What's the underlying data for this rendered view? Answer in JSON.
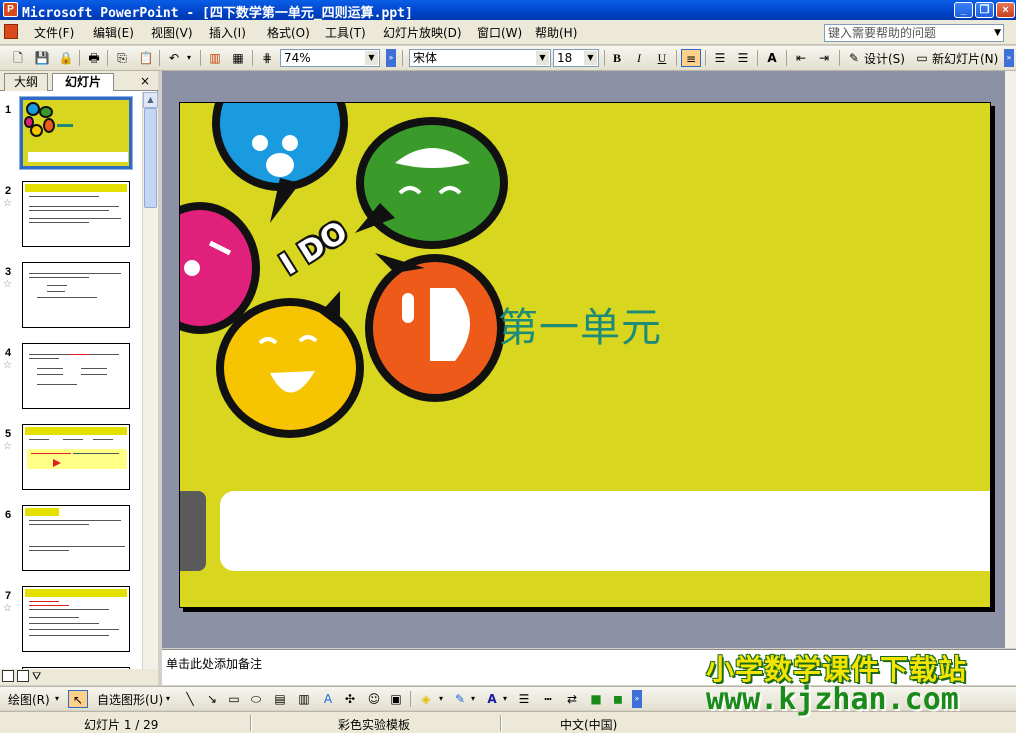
{
  "window": {
    "title": "Microsoft PowerPoint - [四下数学第一单元_四则运算.ppt]"
  },
  "menu": {
    "items": [
      "文件(F)",
      "编辑(E)",
      "视图(V)",
      "插入(I)",
      "格式(O)",
      "工具(T)",
      "幻灯片放映(D)",
      "窗口(W)",
      "帮助(H)"
    ],
    "help_placeholder": "键入需要帮助的问题"
  },
  "toolbar": {
    "zoom": "74%",
    "font": "宋体",
    "size": "18",
    "bold": "B",
    "italic": "I",
    "underline": "U",
    "design": "设计(S)",
    "new_slide": "新幻灯片(N)"
  },
  "pane": {
    "tab_outline": "大纲",
    "tab_slides": "幻灯片",
    "close": "×",
    "slide_numbers": [
      "1",
      "2",
      "3",
      "4",
      "5",
      "6",
      "7"
    ]
  },
  "slide": {
    "title": "第一单元",
    "logo_text": "I DO"
  },
  "notes": {
    "placeholder": "单击此处添加备注"
  },
  "drawbar": {
    "draw": "绘图(R)",
    "autoshapes": "自选图形(U)"
  },
  "status": {
    "slide_counter": "幻灯片 1 / 29",
    "template": "彩色实验模板",
    "language": "中文(中国)"
  },
  "watermark": {
    "line1": "小学数学课件下载站",
    "line2": "www.kjzhan.com"
  }
}
